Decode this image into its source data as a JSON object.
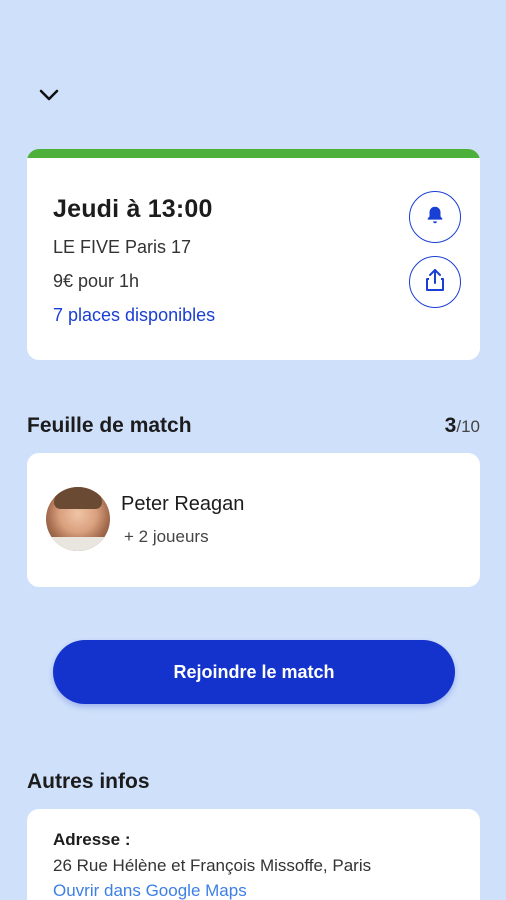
{
  "header": {
    "back_icon": "chevron-down-icon"
  },
  "match": {
    "status_color": "#4db03a",
    "title": "Jeudi à 13:00",
    "venue": "LE FIVE Paris 17",
    "price": "9€ pour 1h",
    "places": "7 places disponibles",
    "actions": {
      "bell_icon": "bell-icon",
      "share_icon": "share-icon"
    }
  },
  "sheet": {
    "title": "Feuille de match",
    "count_current": "3",
    "count_total": "/10",
    "player": {
      "name": "Peter Reagan",
      "extra": "+ 2 joueurs"
    }
  },
  "join_button": {
    "label": "Rejoindre le match",
    "color": "#1433cc"
  },
  "other": {
    "title": "Autres infos",
    "address_label": "Adresse :",
    "address_value": "26 Rue Hélène et François Missoffe, Paris",
    "maps_link": "Ouvrir dans Google Maps"
  },
  "colors": {
    "background": "#cfe0fb",
    "accent": "#1a3fd4",
    "link": "#3d7fe6"
  }
}
